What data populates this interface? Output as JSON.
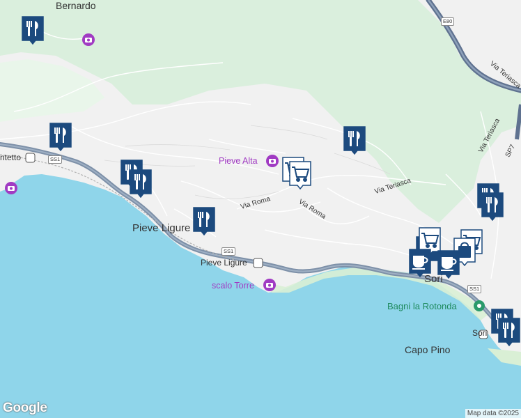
{
  "map": {
    "colors": {
      "sea": "#8fd5ea",
      "land": "#f1f1f1",
      "forest": "#d6efd9",
      "motorway": "#7d90a8",
      "poi_purple": "#a13bc3",
      "pin_blue": "#1c4a7e",
      "park_green": "#2a9a6b"
    },
    "towns": {
      "bernardo": "Bernardo",
      "pieve_ligure": "Pieve Ligure",
      "sori": "Sori",
      "sori_station": "Sori",
      "capo_pino": "Capo Pino",
      "ontetto": "ntetto"
    },
    "pois": {
      "pieve_alta": "Pieve Alta",
      "scalo_torre": "scalo Torre",
      "pieve_station": "Pieve Ligure",
      "bagni": "Bagni la Rotonda"
    },
    "streets": {
      "via_roma_1": "Via Roma",
      "via_roma_2": "Via Roma",
      "via_teriasca_1": "Via Teriasca",
      "via_teriasca_2": "Via Teriasca",
      "via_teriasca_3": "Via Teriasca",
      "sp": "SP7"
    },
    "roads": {
      "e80": "E80",
      "ss1_a": "SS1",
      "ss1_b": "SS1",
      "ss1_c": "SS1"
    },
    "markers": [
      {
        "type": "restaurant",
        "icon": "fork-knife-icon"
      },
      {
        "type": "restaurant",
        "icon": "fork-knife-icon"
      },
      {
        "type": "restaurant",
        "icon": "fork-knife-icon"
      },
      {
        "type": "restaurant",
        "icon": "fork-knife-icon"
      },
      {
        "type": "restaurant",
        "icon": "fork-knife-icon"
      },
      {
        "type": "restaurant",
        "icon": "fork-knife-icon"
      },
      {
        "type": "shopping",
        "icon": "shopping-cart-icon"
      },
      {
        "type": "shopping",
        "icon": "shopping-cart-icon"
      },
      {
        "type": "restaurant",
        "icon": "fork-knife-icon"
      },
      {
        "type": "restaurant",
        "icon": "fork-knife-icon"
      },
      {
        "type": "shopping",
        "icon": "shopping-cart-icon"
      },
      {
        "type": "restaurant",
        "icon": "fork-knife-icon"
      },
      {
        "type": "shopping",
        "icon": "shopping-cart-icon"
      },
      {
        "type": "shopping",
        "icon": "shopping-bag-icon"
      },
      {
        "type": "cafe",
        "icon": "coffee-cup-icon"
      },
      {
        "type": "cafe",
        "icon": "coffee-cup-icon"
      },
      {
        "type": "restaurant",
        "icon": "fork-knife-icon"
      },
      {
        "type": "restaurant",
        "icon": "fork-knife-icon"
      }
    ],
    "attribution": {
      "logo": "Google",
      "data": "Map data ©2025"
    }
  }
}
